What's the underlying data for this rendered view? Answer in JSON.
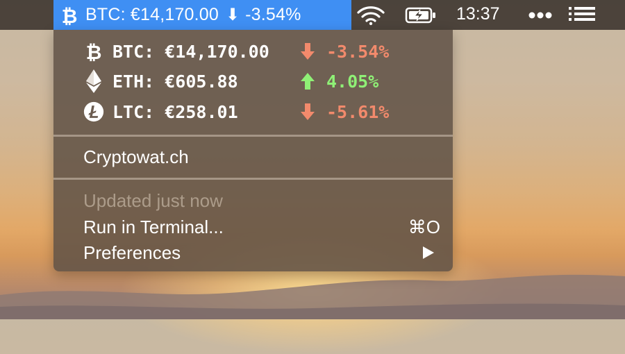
{
  "menubar": {
    "status_title": "BTC: €14,170.00",
    "status_change": "-3.54%",
    "time": "13:37"
  },
  "colors": {
    "accent": "#3f8ff3",
    "down": "#f28a6c",
    "up": "#8ff076"
  },
  "icons": {
    "status": "bitcoin-icon",
    "wifi": "wifi-icon",
    "battery": "battery-charging-icon",
    "more": "more-dots-icon",
    "list": "list-icon"
  },
  "coins": [
    {
      "icon": "bitcoin-icon",
      "label": "BTC: €14,170.00",
      "direction": "down",
      "change": "-3.54%"
    },
    {
      "icon": "ethereum-icon",
      "label": "ETH: €605.88",
      "direction": "up",
      "change": "4.05%"
    },
    {
      "icon": "litecoin-icon",
      "label": "LTC: €258.01",
      "direction": "down",
      "change": "-5.61%"
    }
  ],
  "menu": {
    "site_link": "Cryptowat.ch",
    "updated": "Updated just now",
    "run_terminal": "Run in Terminal...",
    "run_terminal_shortcut": "⌘O",
    "preferences": "Preferences"
  }
}
